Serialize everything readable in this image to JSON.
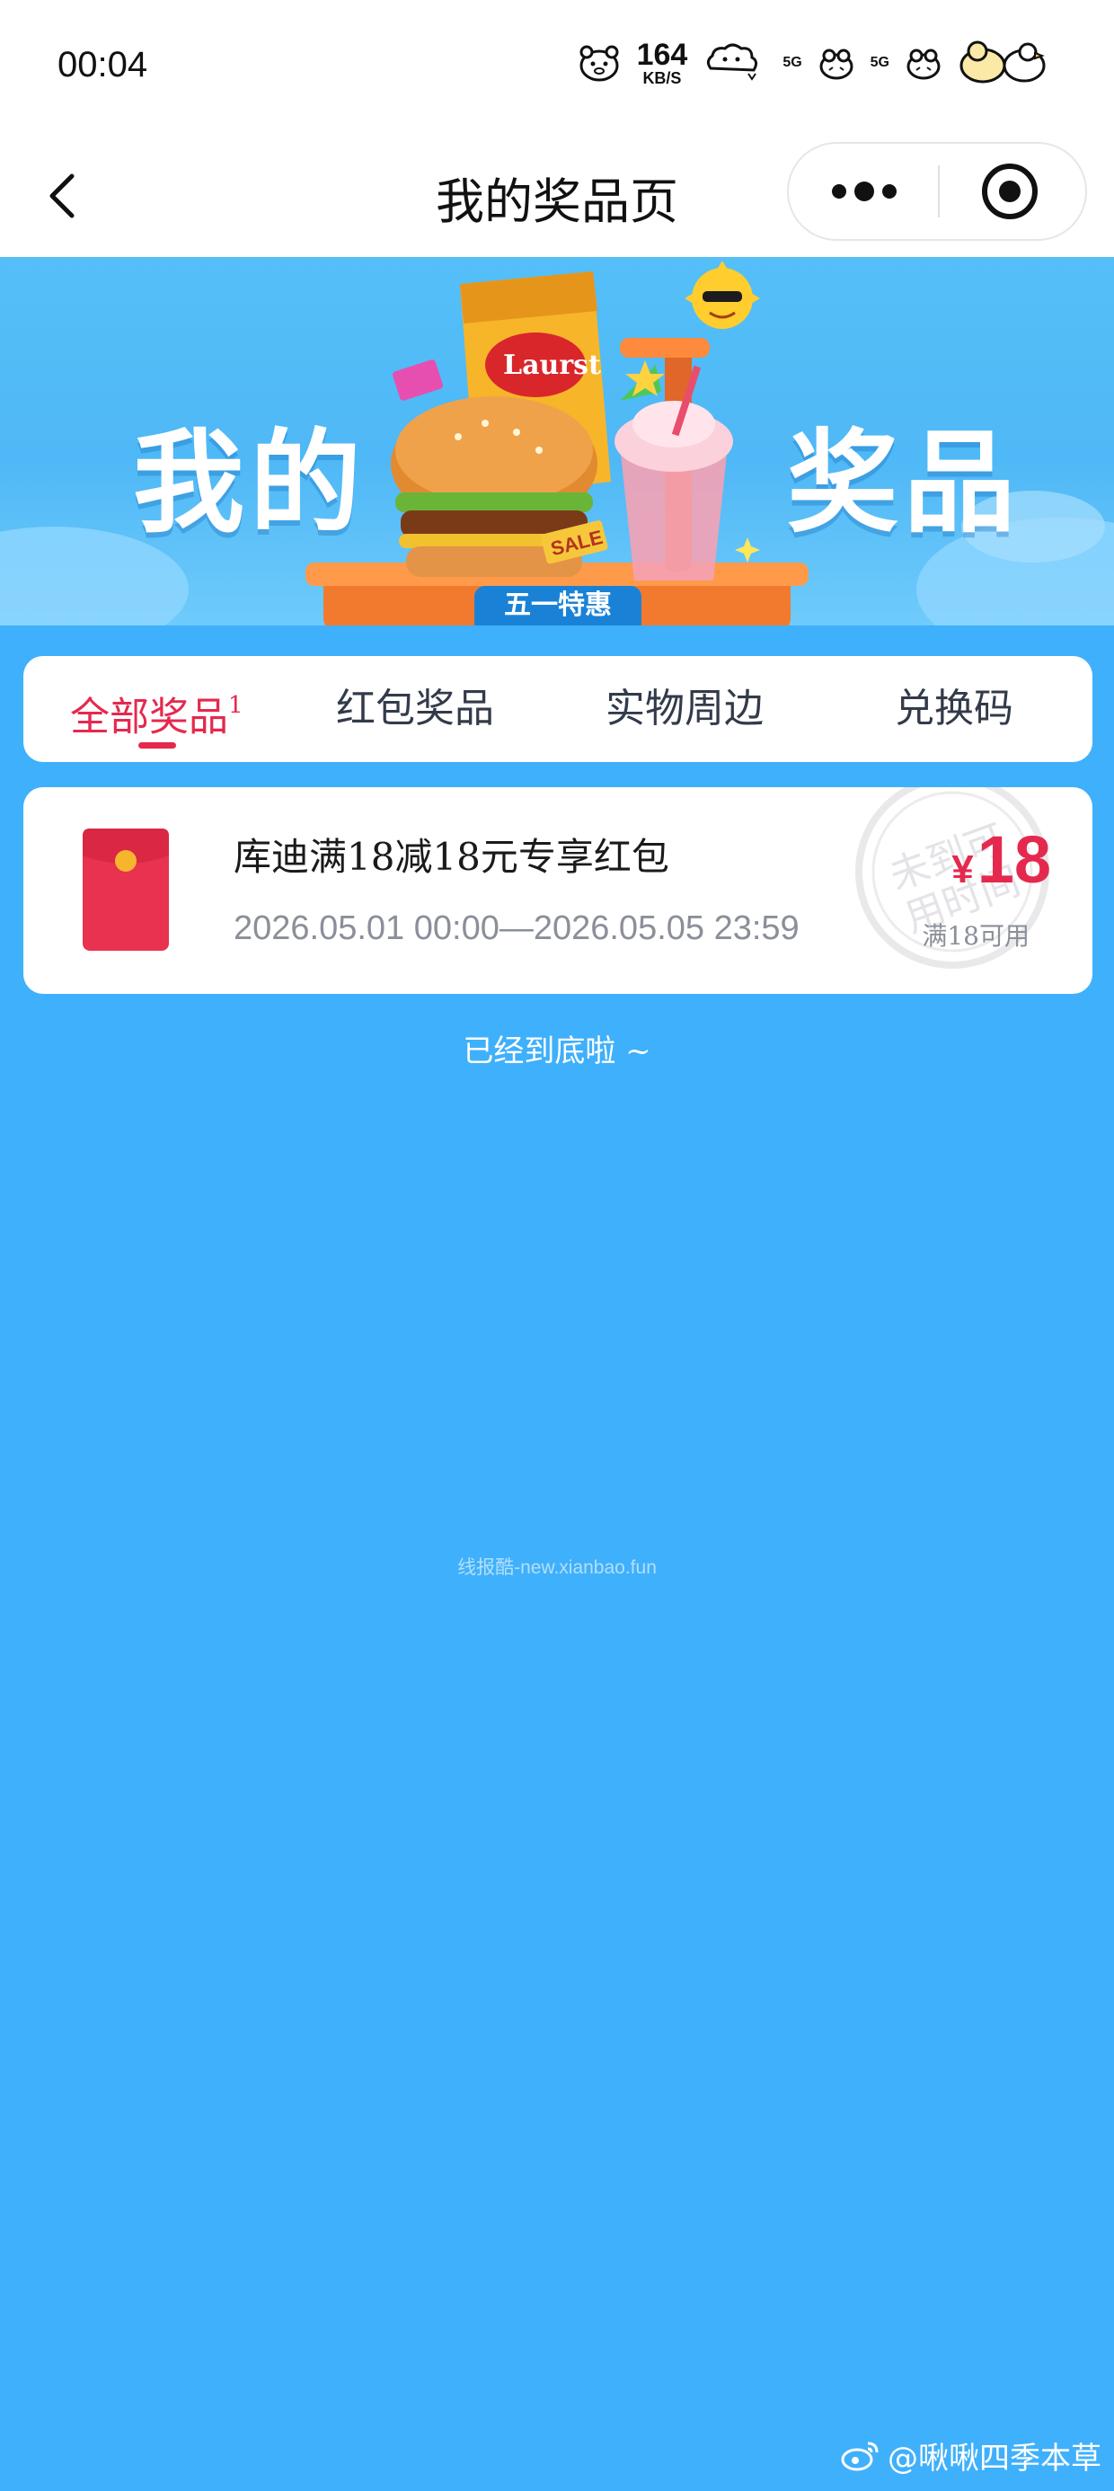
{
  "status_bar": {
    "time": "00:04",
    "net_speed": "164",
    "net_unit": "KB/S",
    "sim1": "5G",
    "sim2": "5G"
  },
  "nav": {
    "title": "我的奖品页",
    "back_icon": "chevron-left-icon",
    "more_icon": "more-dots-icon",
    "close_icon": "target-close-icon"
  },
  "banner": {
    "left_text": "我的",
    "right_text": "奖品",
    "badge": "五一特惠",
    "chips_brand": "Laurst",
    "sale_tag": "SALE"
  },
  "tabs": [
    {
      "label": "全部奖品",
      "count": "1",
      "active": true
    },
    {
      "label": "红包奖品",
      "active": false
    },
    {
      "label": "实物周边",
      "active": false
    },
    {
      "label": "兑换码",
      "active": false
    }
  ],
  "prizes": [
    {
      "title": "库迪满18减18元专享红包",
      "validity": "2026.05.01 00:00—2026.05.05 23:59",
      "currency": "¥",
      "amount": "18",
      "condition": "满18可用",
      "stamp_line1": "未到可",
      "stamp_line2": "用时间"
    }
  ],
  "list_end_text": "已经到底啦 ~",
  "watermark_mid": "线报酷-new.xianbao.fun",
  "watermark_corner": "@啾啾四季本草",
  "colors": {
    "background": "#3fb0fb",
    "accent": "#e5294e",
    "card": "#ffffff"
  }
}
